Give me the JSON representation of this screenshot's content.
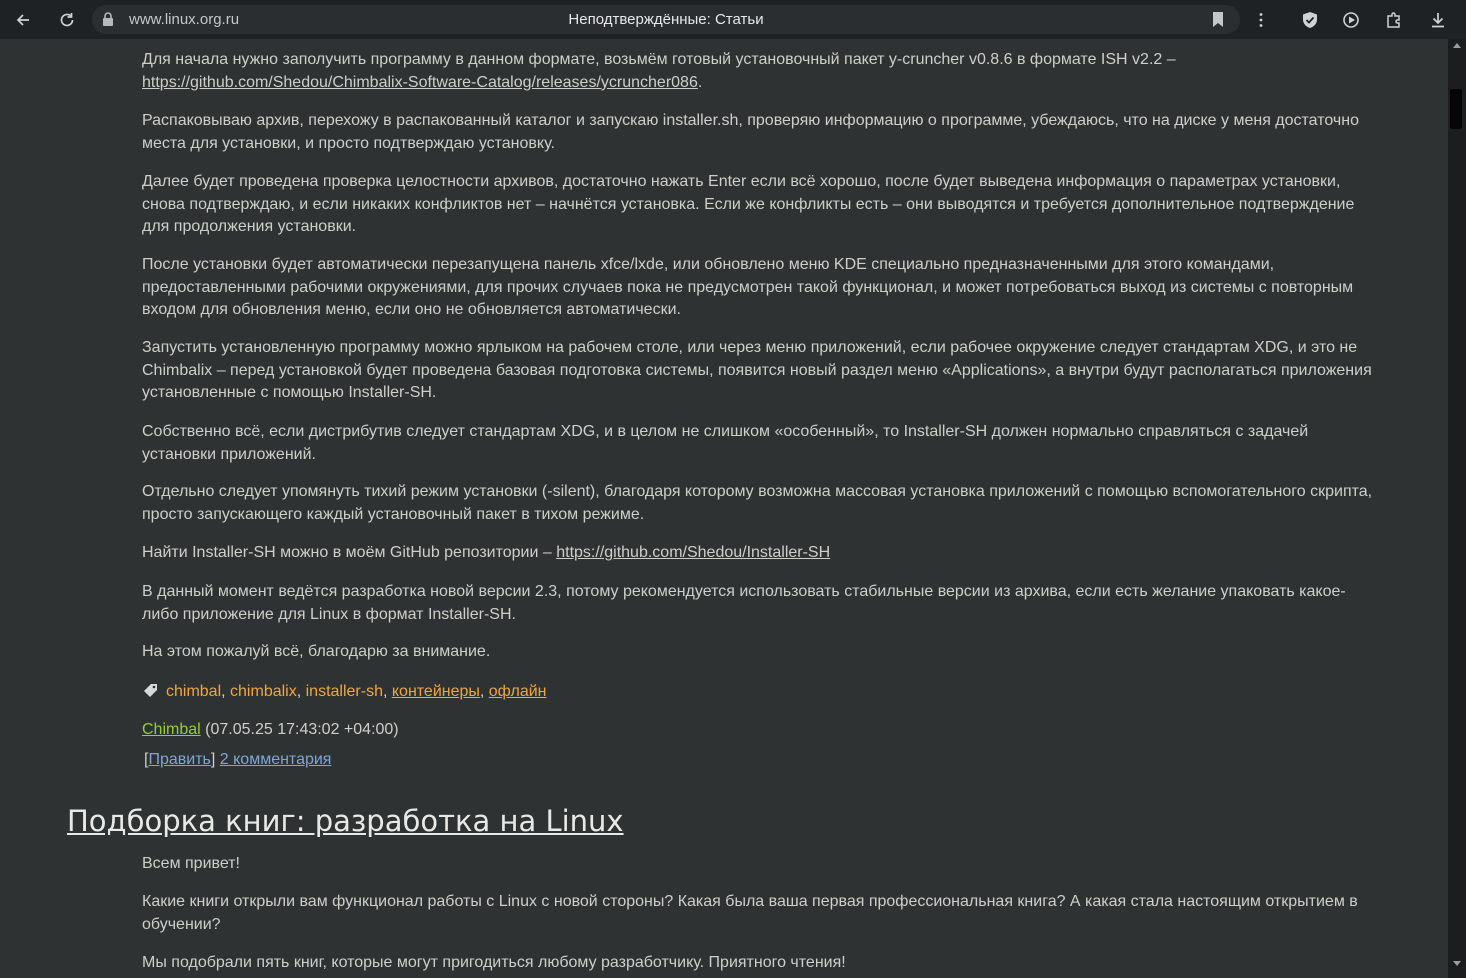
{
  "browser": {
    "url": "www.linux.org.ru",
    "tab_title": "Неподтверждённые: Статьи"
  },
  "article1": {
    "paragraphs": [
      "Для начала нужно заполучить программу в данном формате, возьмём готовый установочный пакет y-cruncher v0.8.6 в формате ISH v2.2 –",
      "Распаковываю архив, перехожу в распакованный каталог и запускаю installer.sh, проверяю информацию о программе, убеждаюсь, что на диске у меня достаточно места для установки, и просто подтверждаю установку.",
      "Далее будет проведена проверка целостности архивов, достаточно нажать Enter если всё хорошо, после будет выведена информация о параметрах установки, снова подтверждаю, и если никаких конфликтов нет – начнётся установка. Если же конфликты есть – они выводятся и требуется дополнительное подтверждение для продолжения установки.",
      "После установки будет автоматически перезапущена панель xfce/lxde, или обновлено меню KDE специально предназначенными для этого командами, предоставленными рабочими окружениями, для прочих случаев пока не предусмотрен такой функционал, и может потребоваться выход из системы с повторным входом для обновления меню, если оно не обновляется автоматически.",
      "Запустить установленную программу можно ярлыком на рабочем столе, или через меню приложений, если рабочее окружение следует стандартам XDG, и это не Chimbalix – перед установкой будет проведена базовая подготовка системы, появится новый раздел меню «Applications», а внутри будут располагаться приложения установленные с помощью Installer-SH.",
      "Собственно всё, если дистрибутив следует стандартам XDG, и в целом не слишком «особенный», то Installer-SH должен нормально справляться с задачей установки приложений.",
      "Отдельно следует упомянуть тихий режим установки (-silent), благодаря которому возможна массовая установка приложений с помощью вспомогательного скрипта, просто запускающего каждый установочный пакет в тихом режиме.",
      "Найти Installer-SH можно в моём GitHub репозитории –",
      "В данный момент ведётся разработка новой версии 2.3, потому рекомендуется использовать стабильные версии из архива, если есть желание упаковать какое-либо приложение для Linux в формат Installer-SH.",
      "На этом пожалуй всё, благодарю за внимание."
    ],
    "link1": "https://github.com/Shedou/Chimbalix-Software-Catalog/releases/ycruncher086",
    "link1_suffix": ".",
    "link2": "https://github.com/Shedou/Installer-SH",
    "tags": [
      "chimbal",
      "chimbalix",
      "installer-sh",
      "контейнеры",
      "офлайн"
    ],
    "author": "Chimbal",
    "date": "(07.05.25 17:43:02 +04:00)",
    "edit_label": "Править",
    "comments_label": "2 комментария",
    "bracket_open": "[",
    "bracket_close": "]"
  },
  "article2": {
    "title": "Подборка книг: разработка на Linux",
    "paragraphs": [
      "Всем привет!",
      "Какие книги открыли вам функционал работы с Linux с новой стороны? Какая была ваша первая профессиональная книга? А какая стала настоящим открытием в обучении?",
      "Мы подобрали пять книг, которые могут пригодиться любому разработчику. Приятного чтения!"
    ]
  },
  "icons": [
    "back-icon",
    "reload-icon",
    "lock-icon",
    "bookmark-icon",
    "more-icon",
    "shield-icon",
    "media-icon",
    "extensions-icon",
    "download-icon",
    "tag-icon"
  ],
  "colors": {
    "background": "#2e3232",
    "text": "#cdcfc9",
    "tag": "#f0a640",
    "author": "#8fcf3b",
    "action_link": "#7ea6d6"
  }
}
